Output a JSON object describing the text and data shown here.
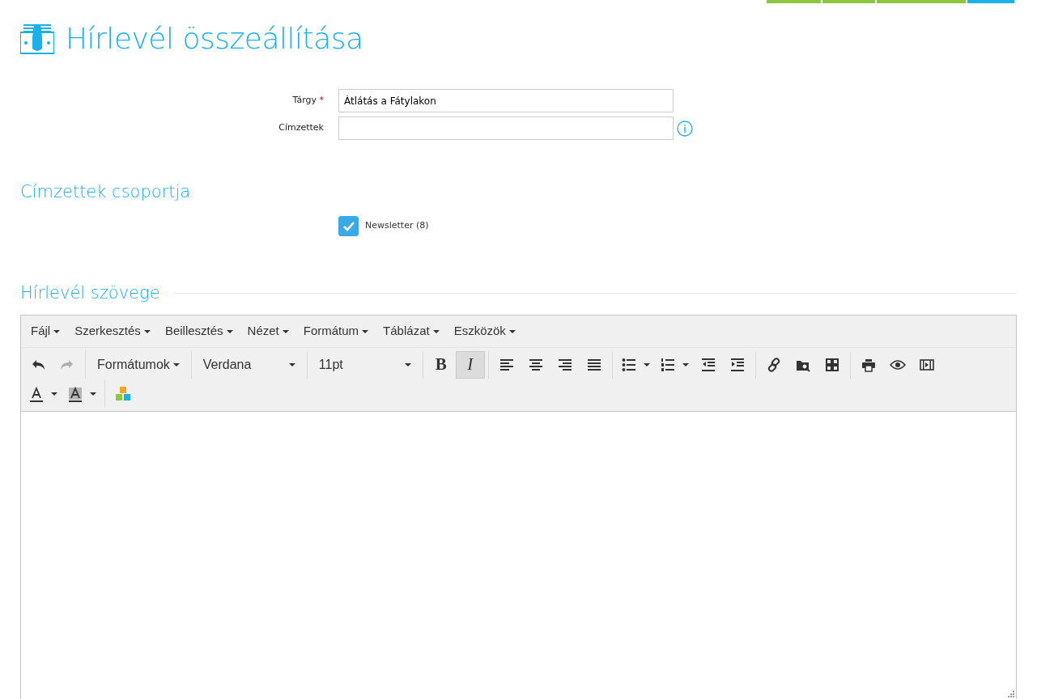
{
  "top_tabs": [
    {
      "selected": false
    },
    {
      "selected": false
    },
    {
      "selected": false
    },
    {
      "selected": true
    }
  ],
  "page": {
    "title": "Hírlevél összeállítása"
  },
  "fields": [
    {
      "label": "Tárgy",
      "required": true,
      "required_mark": "*",
      "value": "Átlátás a Fátylakon",
      "info": false
    },
    {
      "label": "Címzettek",
      "required": false,
      "info": true
    }
  ],
  "groups_section": {
    "title": "Címzettek csoportja",
    "options": [
      {
        "label": "Newsletter (8)",
        "checked": true
      }
    ]
  },
  "text_section": {
    "title": "Hírlevél szövege"
  },
  "editor": {
    "menu": [
      "Fájl",
      "Szerkesztés",
      "Beillesztés",
      "Nézet",
      "Formátum",
      "Táblázat",
      "Eszközök"
    ],
    "undo": {
      "disabled": false
    },
    "redo": {
      "disabled": true
    },
    "formats": "Formátumok",
    "font": "Verdana",
    "size": "11pt",
    "bold": {
      "label": "B",
      "active": false
    },
    "italic": {
      "label": "I",
      "active": true
    }
  }
}
